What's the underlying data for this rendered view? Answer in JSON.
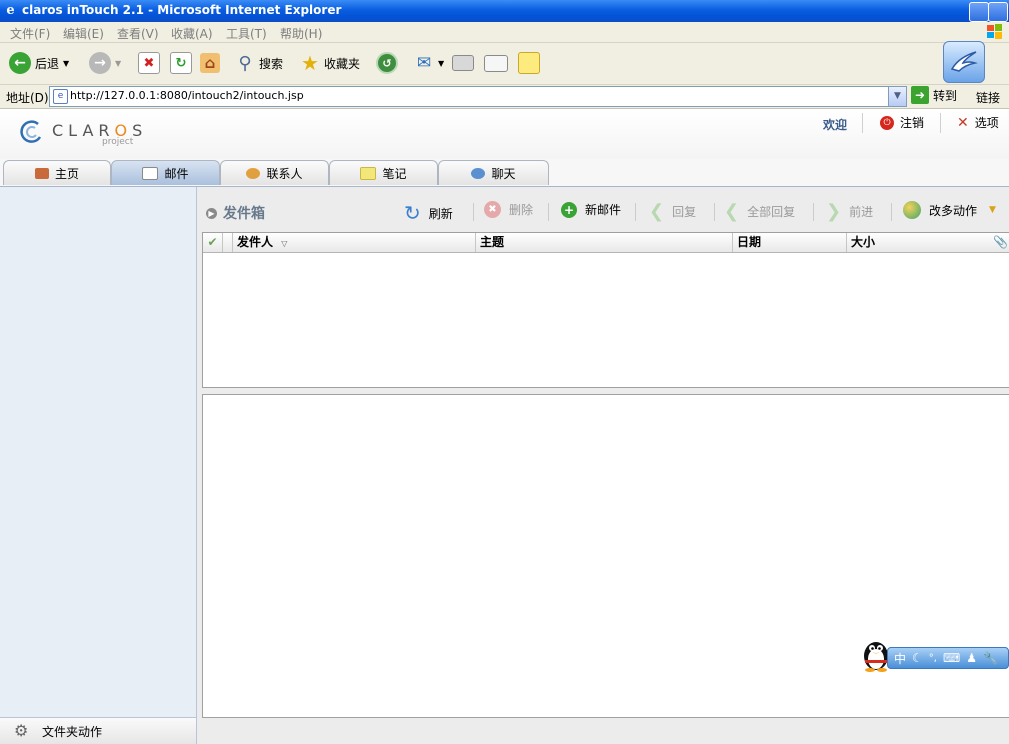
{
  "window": {
    "title": "claros inTouch 2.1 - Microsoft Internet Explorer"
  },
  "menu": [
    "文件(F)",
    "编辑(E)",
    "查看(V)",
    "收藏(A)",
    "工具(T)",
    "帮助(H)"
  ],
  "toolbar": {
    "back": "后退",
    "search": "搜索",
    "favorites": "收藏夹"
  },
  "address": {
    "label": "地址(D)",
    "url": "http://127.0.0.1:8080/intouch2/intouch.jsp",
    "go": "转到",
    "links": "链接"
  },
  "app": {
    "logo_main": "CLAR",
    "logo_o": "O",
    "logo_s": "S",
    "logo_sub": "project",
    "welcome": "欢迎",
    "logout": "注销",
    "options": "选项"
  },
  "tabs": [
    {
      "label": "主页",
      "icon": "home-icon"
    },
    {
      "label": "邮件",
      "icon": "mail-icon",
      "active": true
    },
    {
      "label": "联系人",
      "icon": "contacts-icon"
    },
    {
      "label": "笔记",
      "icon": "notes-icon"
    },
    {
      "label": "聊天",
      "icon": "chat-icon"
    }
  ],
  "mail": {
    "folder": "发件箱",
    "actions": {
      "refresh": "刷新",
      "delete": "删除",
      "new_mail": "新邮件",
      "reply": "回复",
      "reply_all": "全部回复",
      "forward": "前进",
      "more": "改多动作"
    },
    "columns": {
      "sender": "发件人",
      "subject": "主题",
      "date": "日期",
      "size": "大小"
    }
  },
  "sidebar": {
    "folder_actions": "文件夹动作"
  },
  "ime": {
    "mode": "中"
  },
  "colors": {
    "titlebar": "#0554d8",
    "tab_active": "#a9c0dd",
    "sidebar": "#e8eef6"
  }
}
